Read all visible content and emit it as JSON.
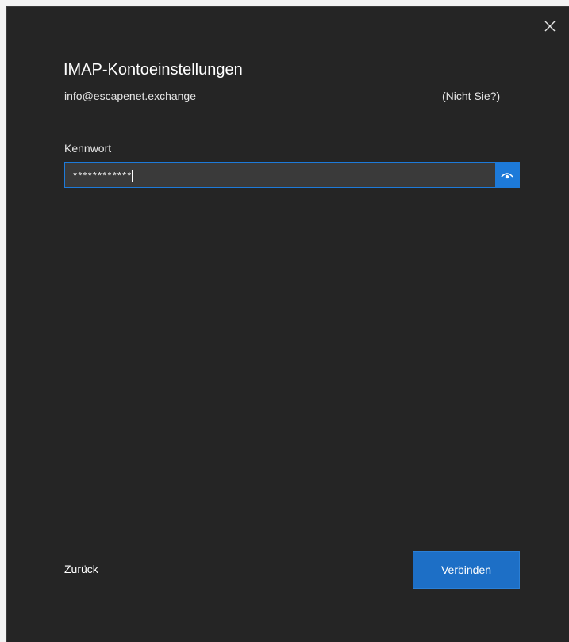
{
  "dialog": {
    "title": "IMAP-Kontoeinstellungen",
    "email": "info@escapenet.exchange",
    "not_you_link": "(Nicht Sie?)",
    "close_icon": "close-icon"
  },
  "password": {
    "label": "Kennwort",
    "masked_value": "************",
    "reveal_icon": "eye-icon",
    "focused": true
  },
  "footer": {
    "back_label": "Zurück",
    "connect_label": "Verbinden"
  },
  "colors": {
    "background": "#252525",
    "accent": "#1d7ad9",
    "text": "#ffffff"
  }
}
